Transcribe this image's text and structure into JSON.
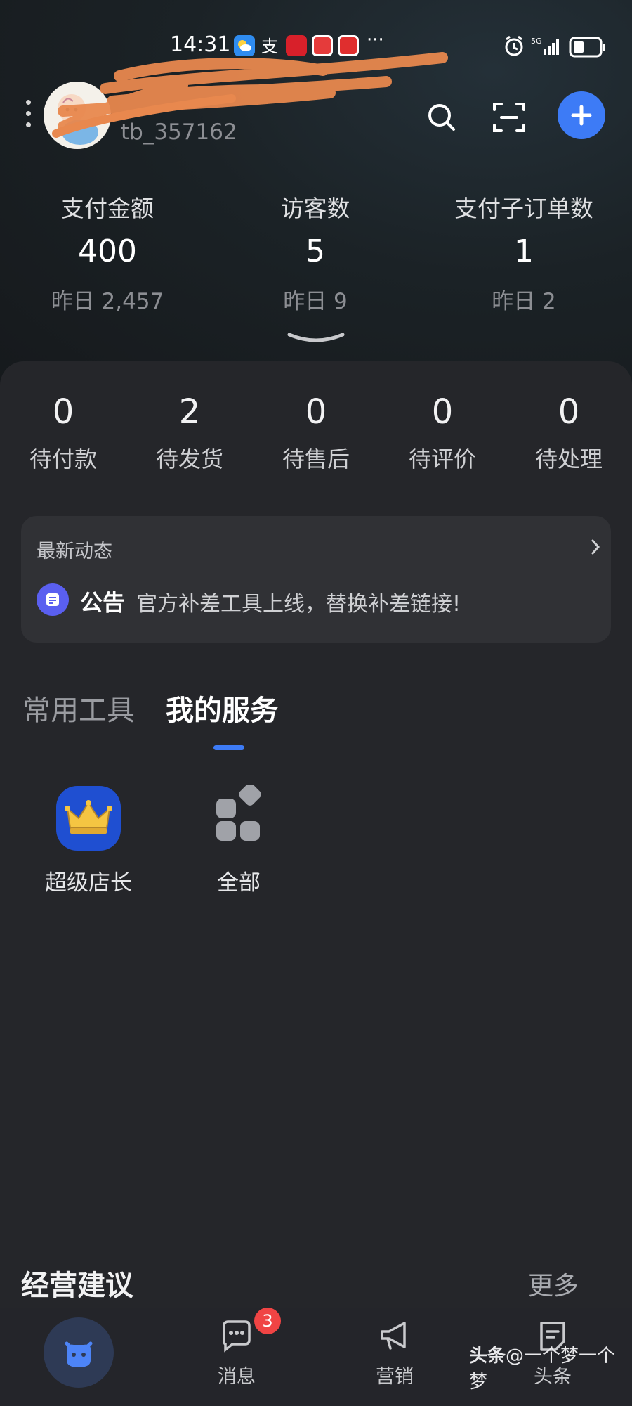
{
  "status_bar": {
    "time": "14:31",
    "dots": "···",
    "network": "5G",
    "icons": [
      "weather-icon",
      "alipay-icon",
      "app-icon",
      "app-icon",
      "app-icon",
      "alarm-icon",
      "signal-icon",
      "battery-icon"
    ]
  },
  "header": {
    "shop_name": "",
    "shop_id": "tb_357162",
    "icons": [
      "more-icon",
      "search-icon",
      "scan-icon",
      "add-icon"
    ],
    "accent_color": "#3d7bf6"
  },
  "stats": [
    {
      "label": "支付金额",
      "value": "400",
      "yesterday": "昨日 2,457"
    },
    {
      "label": "访客数",
      "value": "5",
      "yesterday": "昨日 9"
    },
    {
      "label": "支付子订单数",
      "value": "1",
      "yesterday": "昨日 2"
    }
  ],
  "orders": [
    {
      "count": "0",
      "label": "待付款"
    },
    {
      "count": "2",
      "label": "待发货"
    },
    {
      "count": "0",
      "label": "待售后"
    },
    {
      "count": "0",
      "label": "待评价"
    },
    {
      "count": "0",
      "label": "待处理"
    }
  ],
  "news": {
    "title": "最新动态",
    "tag": "公告",
    "text": "官方补差工具上线，替换补差链接!"
  },
  "tabs": {
    "tools": "常用工具",
    "services": "我的服务",
    "active": "我的服务"
  },
  "services": [
    {
      "label": "超级店长",
      "icon": "crown-icon"
    },
    {
      "label": "全部",
      "icon": "grid-icon"
    }
  ],
  "advice": {
    "title": "经营建议",
    "more": "更多"
  },
  "bottom_nav": {
    "home_icon": "mascot-icon",
    "items": [
      {
        "label": "消息",
        "icon": "message-icon",
        "badge": "3"
      },
      {
        "label": "营销",
        "icon": "megaphone-icon"
      },
      {
        "label": "头条",
        "icon": "document-icon"
      }
    ],
    "badge_color": "#f04444"
  },
  "watermark": {
    "brand": "头条",
    "handle": "@一个梦一个梦"
  }
}
